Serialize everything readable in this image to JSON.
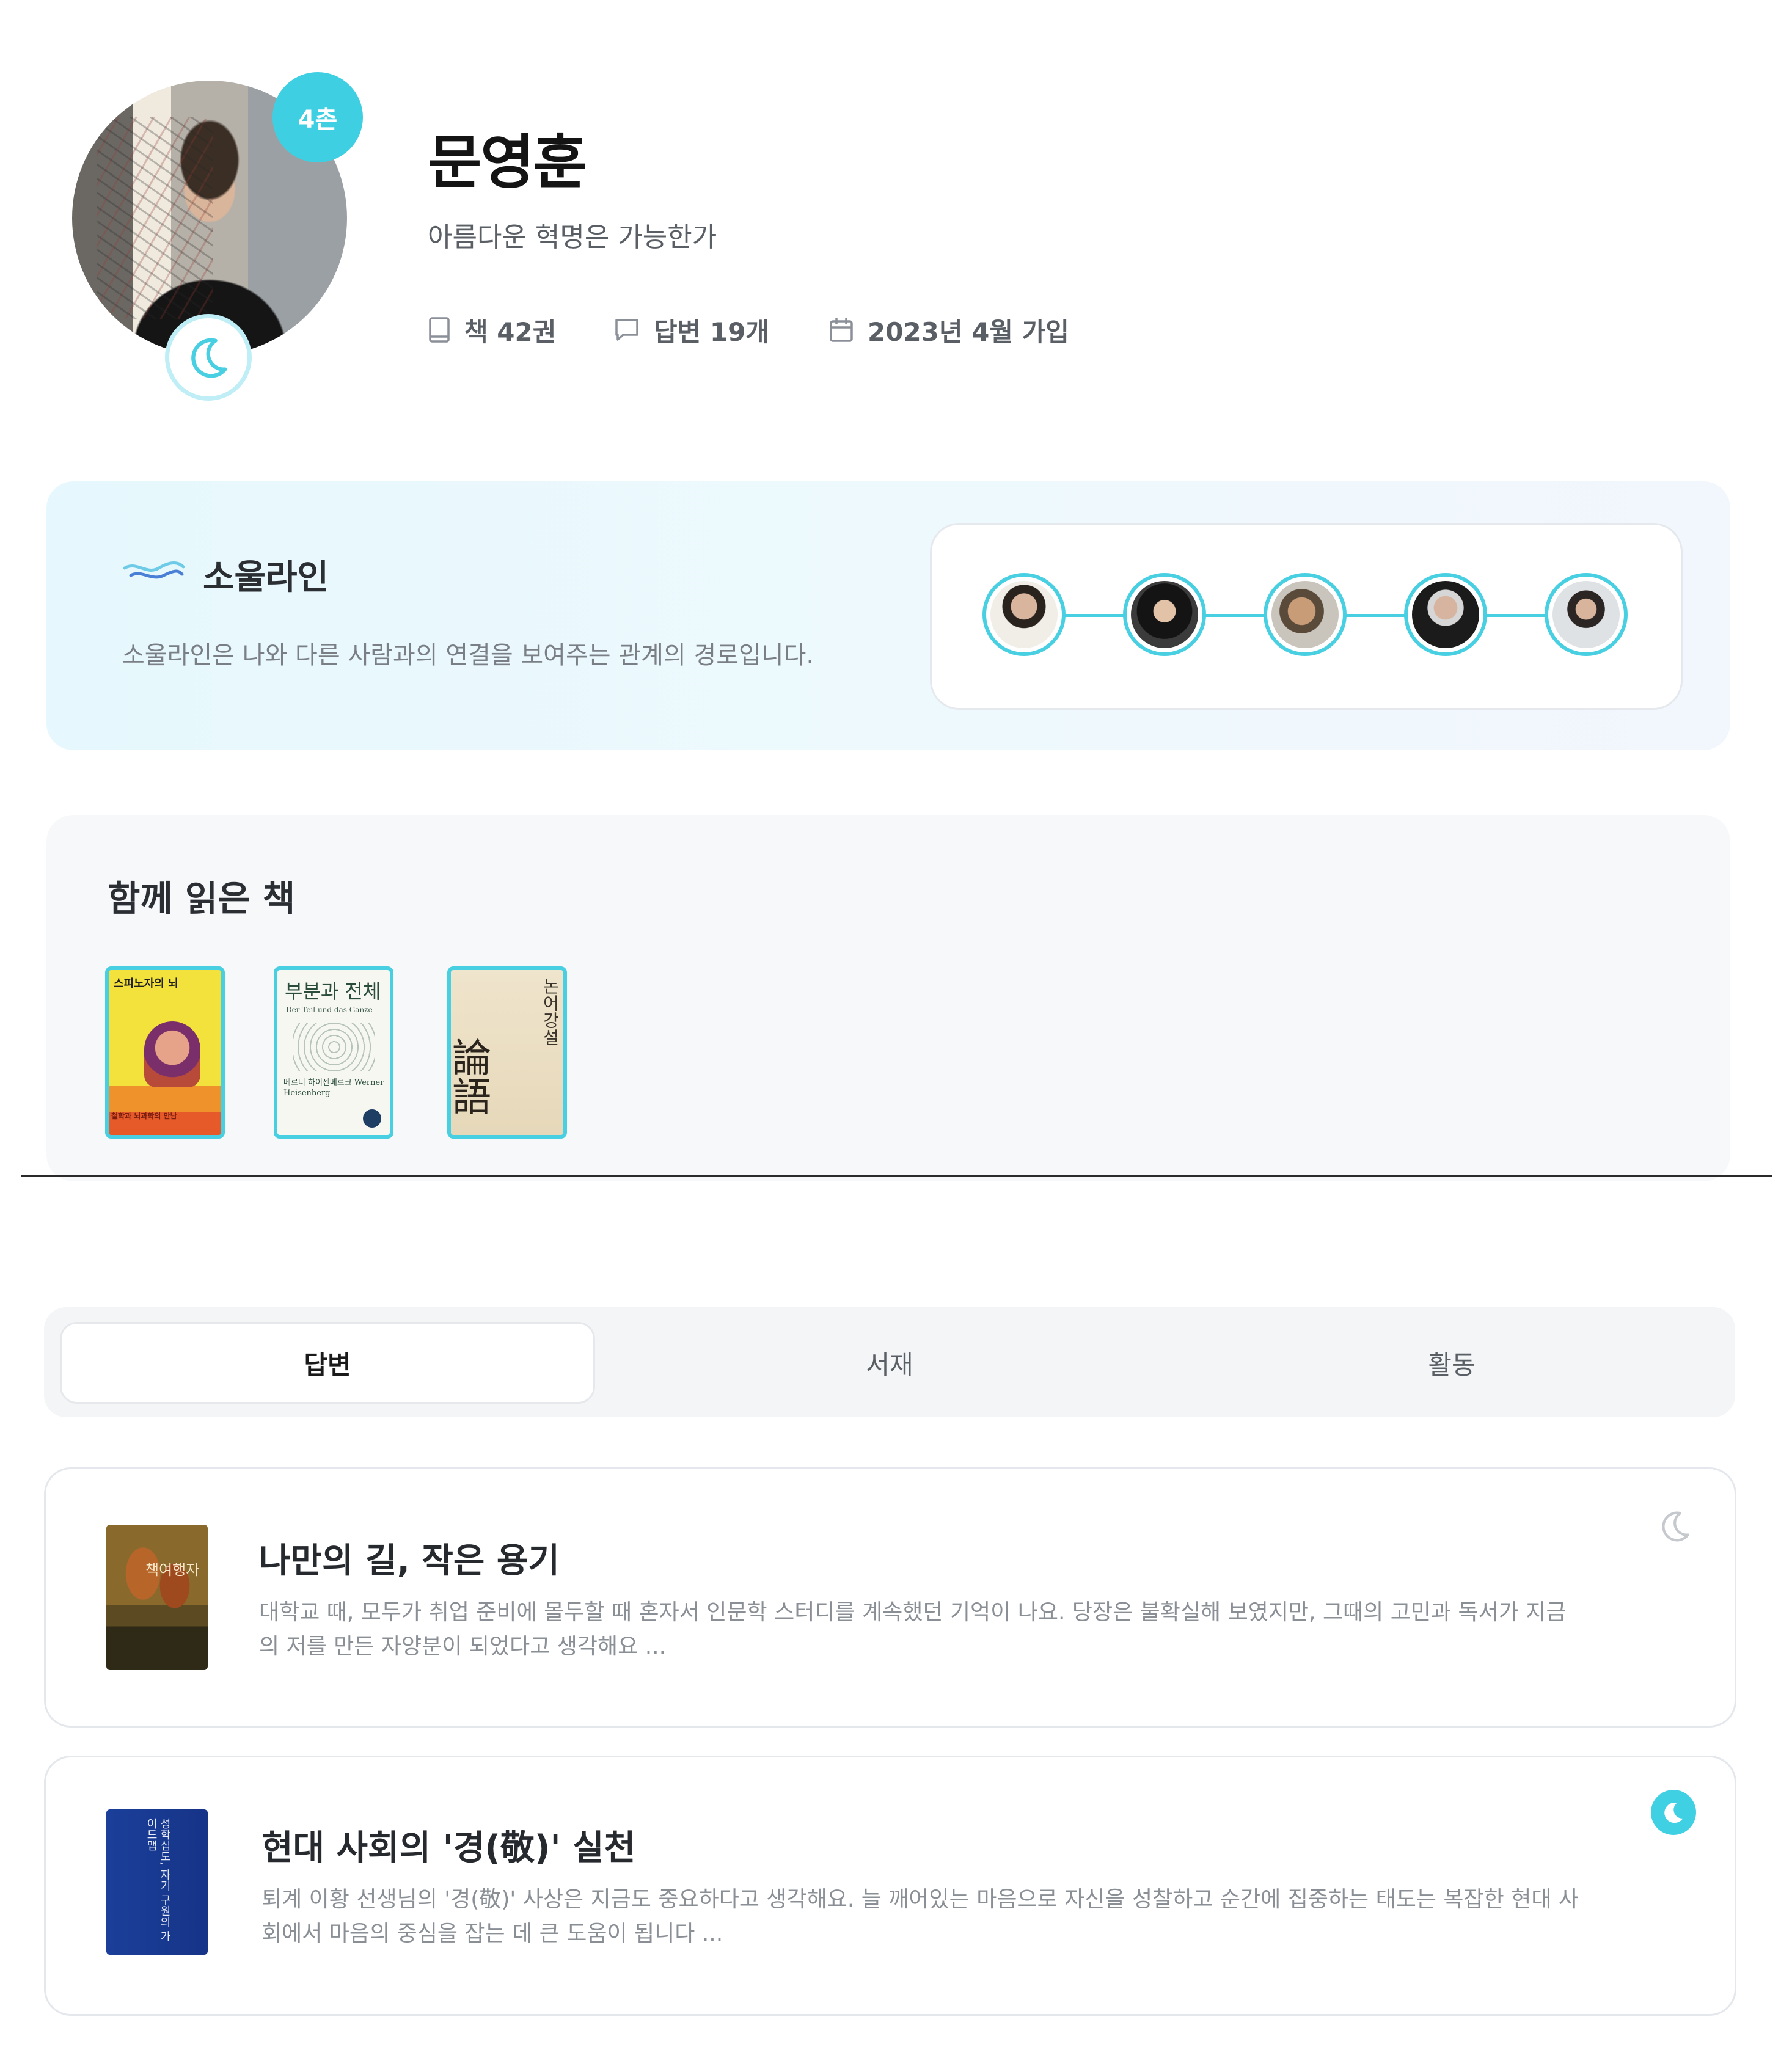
{
  "profile": {
    "name": "문영훈",
    "bio": "아름다운 혁명은 가능한가",
    "chon_badge": "4촌",
    "stats": {
      "books": "책 42권",
      "answers": "답변 19개",
      "joined": "2023년 4월 가입"
    }
  },
  "soulline": {
    "title": "소울라인",
    "description": "소울라인은 나와 다른 사람과의 연결을 보여주는 관계의 경로입니다.",
    "chain_count": 5
  },
  "shared_books": {
    "title": "함께 읽은 책",
    "books": [
      {
        "cover_title": "스피노자의 뇌",
        "cover_sub": "철학과 뇌과학의 만남",
        "icon": "book-cover-spinoza"
      },
      {
        "cover_title": "부분과 전체",
        "cover_sub": "Der Teil und das Ganze",
        "cover_author": "베르너 하이젠베르크 Werner Heisenberg",
        "icon": "book-cover-heisenberg"
      },
      {
        "cover_title": "논어강설",
        "cover_sub": "論語",
        "icon": "book-cover-analects"
      }
    ]
  },
  "tabs": [
    {
      "label": "답변",
      "active": true
    },
    {
      "label": "서재",
      "active": false
    },
    {
      "label": "활동",
      "active": false
    }
  ],
  "answers": [
    {
      "title": "나만의 길, 작은 용기",
      "excerpt": "대학교 때, 모두가 취업 준비에 몰두할 때 혼자서 인문학 스터디를 계속했던 기억이 나요. 당장은 불확실해 보였지만, 그때의 고민과 독서가 지금의 저를 만든 자양분이 되었다고 생각해요 ...",
      "cover_text": "책여행자",
      "moon_active": false
    },
    {
      "title": "현대 사회의 '경(敬)' 실천",
      "excerpt": "퇴계 이황 선생님의 '경(敬)' 사상은 지금도 중요하다고 생각해요. 늘 깨어있는 마음으로 자신을 성찰하고 순간에 집중하는 태도는 복잡한 현대 사회에서 마음의 중심을 잡는 데 큰 도움이 됩니다 ...",
      "cover_text": "성학십도, 자기 구원의 가이드맵",
      "moon_active": true
    }
  ],
  "colors": {
    "accent": "#49cfe2",
    "badge": "#3fcfe3",
    "soulline_bg": "#e6f8fd",
    "card_bg": "#f7f8fa"
  }
}
